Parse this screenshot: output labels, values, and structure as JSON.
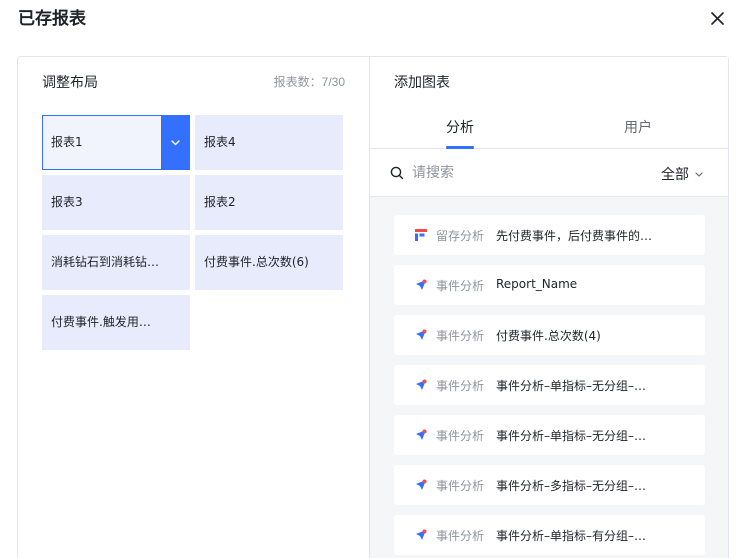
{
  "dialog": {
    "title": "已存报表"
  },
  "left": {
    "title": "调整布局",
    "count_label": "报表数：",
    "count_value": "7/30",
    "tiles": [
      {
        "label": "报表1",
        "selected": true
      },
      {
        "label": "报表4"
      },
      {
        "label": "报表3"
      },
      {
        "label": "报表2"
      },
      {
        "label": "消耗钻石到消耗钻…"
      },
      {
        "label": "付费事件.总次数(6)"
      },
      {
        "label": "付费事件.触发用…"
      }
    ]
  },
  "right": {
    "title": "添加图表",
    "tabs": [
      {
        "label": "分析",
        "active": true
      },
      {
        "label": "用户"
      }
    ],
    "search": {
      "placeholder": "请搜索",
      "value": ""
    },
    "filter": {
      "label": "全部"
    },
    "items": [
      {
        "icon": "retention-icon",
        "type": "留存分析",
        "name": "先付费事件，后付费事件的…"
      },
      {
        "icon": "event-icon",
        "type": "事件分析",
        "name": "Report_Name"
      },
      {
        "icon": "event-icon",
        "type": "事件分析",
        "name": "付费事件.总次数(4)"
      },
      {
        "icon": "event-icon",
        "type": "事件分析",
        "name": "事件分析–单指标–无分组–…"
      },
      {
        "icon": "event-icon",
        "type": "事件分析",
        "name": "事件分析–单指标–无分组–…"
      },
      {
        "icon": "event-icon",
        "type": "事件分析",
        "name": "事件分析–多指标–无分组–…"
      },
      {
        "icon": "event-icon",
        "type": "事件分析",
        "name": "事件分析–单指标–有分组–…"
      }
    ]
  },
  "colors": {
    "accent": "#3370ff",
    "tile_bg": "#e8ebfb",
    "retention_red": "#f54a45",
    "event_orange": "#ff7d00"
  }
}
